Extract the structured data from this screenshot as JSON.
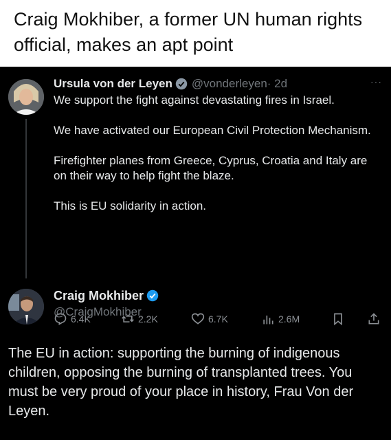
{
  "caption": "Craig Mokhiber, a former UN human rights official, makes an apt point",
  "tweet1": {
    "name": "Ursula von der Leyen",
    "handle": "@vonderleyen",
    "time": "· 2d",
    "more": "···",
    "body": "We support the fight against devastating fires in Israel.\n\nWe have activated our European Civil Protection Mechanism.\n\nFirefighter planes from Greece, Cyprus, Croatia and Italy are on their way to help fight the blaze.\n\nThis is EU solidarity in action.",
    "stats": {
      "replies": "6.4K",
      "reposts": "2.2K",
      "likes": "6.7K",
      "views": "2.6M"
    }
  },
  "tweet2": {
    "name": "Craig Mokhiber",
    "handle": "@CraigMokhiber",
    "body": "The EU in action: supporting the burning of indigenous children, opposing the burning of transplanted trees. You must be very proud of your place in history, Frau Von der Leyen."
  },
  "colors": {
    "verified": "#1d9bf0",
    "muted": "#71767b",
    "text": "#e7e9ea"
  },
  "icons": [
    "reply-icon",
    "repost-icon",
    "like-icon",
    "views-icon",
    "bookmark-icon",
    "share-icon",
    "verified-badge-icon"
  ]
}
